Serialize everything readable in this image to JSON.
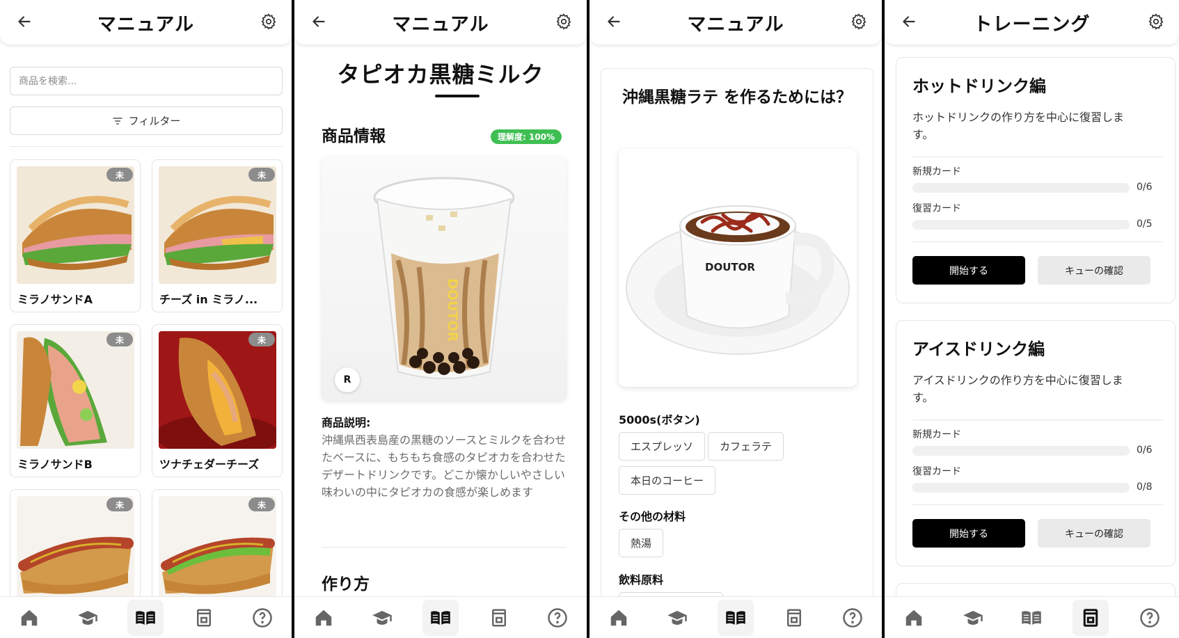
{
  "screens": {
    "catalog": {
      "title": "マニュアル",
      "search_placeholder": "商品を検索...",
      "filter_label": "フィルター",
      "items": [
        {
          "name": "ミラノサンドA",
          "badge": "未"
        },
        {
          "name": "チーズ in ミラノ...",
          "badge": "未"
        },
        {
          "name": "ミラノサンドB",
          "badge": "未"
        },
        {
          "name": "ツナチェダーチーズ",
          "badge": "未"
        },
        {
          "name": "",
          "badge": "未"
        },
        {
          "name": "",
          "badge": "未"
        }
      ]
    },
    "product": {
      "title": "マニュアル",
      "product_name": "タピオカ黒糖ミルク",
      "section_info": "商品情報",
      "understanding_label": "理解度: 100%",
      "understanding_value": 100,
      "size_badge": "R",
      "logo_text": "DOUTOR",
      "description_label": "商品説明:",
      "description": "沖縄県西表島産の黒糖のソースとミルクを合わせたベースに、もちもち食感のタピオカを合わせたデザートドリンクです。どこか懐かしいやさしい味わいの中にタピオカの食感が楽しめます",
      "section_howto": "作り方"
    },
    "quiz": {
      "title": "マニュアル",
      "question": "沖縄黒糖ラテ を作るためには？",
      "cup_logo": "DOUTOR",
      "groups": [
        {
          "label": "5000s(ボタン)",
          "options": [
            "エスプレッソ",
            "カフェラテ",
            "本日のコーヒー"
          ]
        },
        {
          "label": "その他の材料",
          "options": [
            "熱湯"
          ]
        },
        {
          "label": "飲料原料",
          "options": []
        }
      ]
    },
    "training": {
      "title": "トレーニング",
      "decks": [
        {
          "title": "ホットドリンク編",
          "description": "ホットドリンクの作り方を中心に復習します。",
          "new_label": "新規カード",
          "new_count": "0/6",
          "new_progress": 0,
          "review_label": "復習カード",
          "review_count": "0/5",
          "review_progress": 0,
          "start_label": "開始する",
          "queue_label": "キューの確認"
        },
        {
          "title": "アイスドリンク編",
          "description": "アイスドリンクの作り方を中心に復習します。",
          "new_label": "新規カード",
          "new_count": "0/6",
          "new_progress": 0,
          "review_label": "復習カード",
          "review_count": "0/8",
          "review_progress": 0,
          "start_label": "開始する",
          "queue_label": "キューの確認"
        }
      ]
    }
  },
  "nav_icons": [
    "home-icon",
    "graduation-cap-icon",
    "manual-book-icon",
    "coffee-machine-icon",
    "help-icon"
  ],
  "active_nav": {
    "catalog": 2,
    "product": 2,
    "quiz": 2,
    "training": 3
  },
  "colors": {
    "accent_green": "#3fbf52",
    "badge_gray": "#8c8c8c",
    "primary_button": "#000000",
    "secondary_button": "#eaeaea"
  }
}
